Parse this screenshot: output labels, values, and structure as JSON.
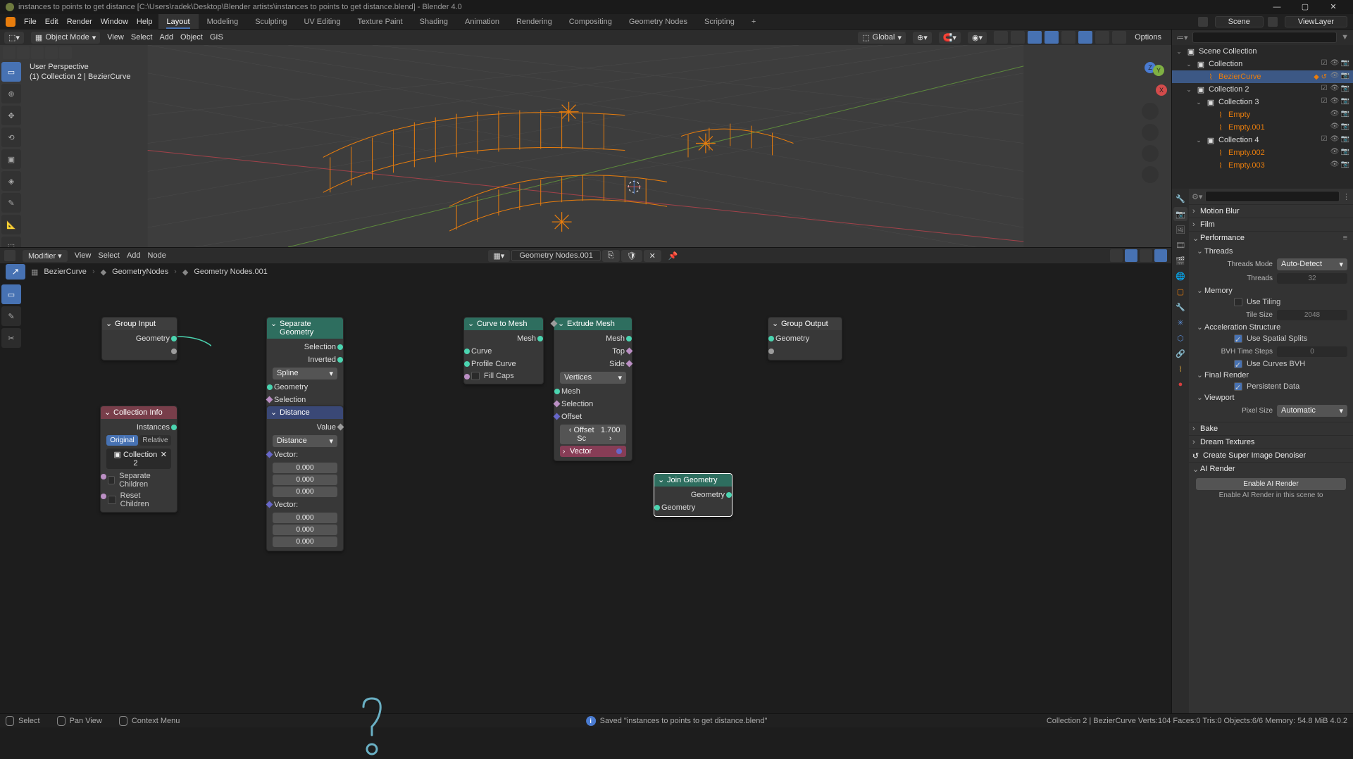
{
  "titlebar": {
    "title": "instances to points to get distance [C:\\Users\\radek\\Desktop\\Blender artists\\instances to points to get distance.blend] - Blender 4.0"
  },
  "menubar": [
    "File",
    "Edit",
    "Render",
    "Window",
    "Help"
  ],
  "workspaces": [
    "Layout",
    "Modeling",
    "Sculpting",
    "UV Editing",
    "Texture Paint",
    "Shading",
    "Animation",
    "Rendering",
    "Compositing",
    "Geometry Nodes",
    "Scripting"
  ],
  "active_workspace": "Layout",
  "scene": {
    "label": "Scene"
  },
  "view_layer": {
    "label": "ViewLayer"
  },
  "viewport": {
    "mode_label": "Object Mode",
    "menus": [
      "View",
      "Select",
      "Add",
      "Object",
      "GIS"
    ],
    "orientation": "Global",
    "options_label": "Options",
    "overlay1": "User Perspective",
    "overlay2": "(1) Collection 2 | BezierCurve"
  },
  "node_editor": {
    "dropdown": "Modifier",
    "menus": [
      "View",
      "Select",
      "Add",
      "Node"
    ],
    "group_name": "Geometry Nodes.001",
    "breadcrumb": [
      "BezierCurve",
      "GeometryNodes",
      "Geometry Nodes.001"
    ]
  },
  "nodes": {
    "group_input": {
      "title": "Group Input",
      "out_geo": "Geometry"
    },
    "collection_info": {
      "title": "Collection Info",
      "out_inst": "Instances",
      "orig": "Original",
      "rel": "Relative",
      "collection": "Collection 2",
      "sep": "Separate Children",
      "reset": "Reset Children"
    },
    "separate": {
      "title": "Separate Geometry",
      "out_sel": "Selection",
      "out_inv": "Inverted",
      "domain": "Spline",
      "in_geo": "Geometry",
      "in_sel": "Selection"
    },
    "distance": {
      "title": "Distance",
      "out_val": "Value",
      "mode": "Distance",
      "in_v1": "Vector:",
      "in_v2": "Vector:",
      "zero": "0.000"
    },
    "curve_to_mesh": {
      "title": "Curve to Mesh",
      "out_mesh": "Mesh",
      "in_curve": "Curve",
      "in_profile": "Profile Curve",
      "fill": "Fill Caps"
    },
    "extrude": {
      "title": "Extrude Mesh",
      "out_mesh": "Mesh",
      "out_top": "Top",
      "out_side": "Side",
      "mode": "Vertices",
      "in_mesh": "Mesh",
      "in_sel": "Selection",
      "in_off": "Offset",
      "offset_label": "Offset Sc",
      "offset_val": "1.700",
      "vec_label": "Vector"
    },
    "join": {
      "title": "Join Geometry",
      "out_geo": "Geometry",
      "in_geo": "Geometry"
    },
    "group_output": {
      "title": "Group Output",
      "in_geo": "Geometry"
    }
  },
  "outliner": {
    "root": "Scene Collection",
    "tree": [
      {
        "label": "Collection",
        "depth": 1,
        "type": "col",
        "arrow": true
      },
      {
        "label": "BezierCurve",
        "depth": 2,
        "type": "obj",
        "selected": true,
        "extra_icons": true
      },
      {
        "label": "Collection 2",
        "depth": 1,
        "type": "col",
        "arrow": true
      },
      {
        "label": "Collection 3",
        "depth": 2,
        "type": "col",
        "arrow": true
      },
      {
        "label": "Empty",
        "depth": 3,
        "type": "obj"
      },
      {
        "label": "Empty.001",
        "depth": 3,
        "type": "obj"
      },
      {
        "label": "Collection 4",
        "depth": 2,
        "type": "col",
        "arrow": true
      },
      {
        "label": "Empty.002",
        "depth": 3,
        "type": "obj"
      },
      {
        "label": "Empty.003",
        "depth": 3,
        "type": "obj"
      }
    ]
  },
  "properties": {
    "motion_blur": "Motion Blur",
    "film": "Film",
    "performance": "Performance",
    "threads": "Threads",
    "threads_mode_label": "Threads Mode",
    "threads_mode_val": "Auto-Detect",
    "threads_label": "Threads",
    "threads_val": "32",
    "memory": "Memory",
    "use_tiling": "Use Tiling",
    "tile_size_label": "Tile Size",
    "tile_size_val": "2048",
    "accel": "Acceleration Structure",
    "spatial": "Use Spatial Splits",
    "bvh_label": "BVH Time Steps",
    "bvh_val": "0",
    "curves_bvh": "Use Curves BVH",
    "final_render": "Final Render",
    "persistent": "Persistent Data",
    "viewport": "Viewport",
    "pixel_size_label": "Pixel Size",
    "pixel_size_val": "Automatic",
    "bake": "Bake",
    "dream": "Dream Textures",
    "sid": "Create Super Image Denoiser",
    "ai_render": "AI Render",
    "enable_ai": "Enable AI Render",
    "enable_ai_desc": "Enable AI Render in this scene to"
  },
  "statusbar": {
    "select": "Select",
    "pan": "Pan View",
    "context": "Context Menu",
    "saved": "Saved \"instances to points to get distance.blend\"",
    "stats": "Collection 2 | BezierCurve    Verts:104    Faces:0    Tris:0    Objects:6/6    Memory: 54.8 MiB    4.0.2"
  }
}
